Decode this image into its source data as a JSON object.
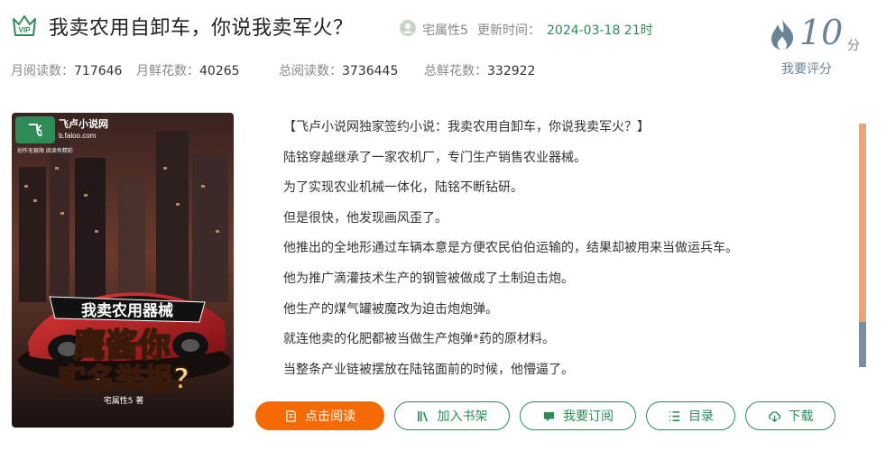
{
  "book": {
    "title": "我卖农用自卸车，你说我卖军火？",
    "author": "宅属性5",
    "update_label": "更新时间：",
    "update_time": "2024-03-18 21时",
    "vip_badge": "VIP"
  },
  "stats": [
    {
      "label": "月阅读数：",
      "value": "717646"
    },
    {
      "label": "月鲜花数：",
      "value": "40265"
    },
    {
      "label": "总阅读数：",
      "value": "3736445"
    },
    {
      "label": "总鲜花数：",
      "value": "332922"
    }
  ],
  "score": {
    "value": "10",
    "unit": "分",
    "rate_label": "我要评分"
  },
  "cover": {
    "site_name": "飞卢小说网",
    "site_url": "b.faloo.com",
    "slogan": "创作无极限 阅读有精彩",
    "banner": "我卖农用器械",
    "big_text_1": "鹰酱你",
    "big_text_2": "实名举报?",
    "author_tag": "宅属性5 著"
  },
  "description": [
    "【飞卢小说网独家签约小说：我卖农用自卸车，你说我卖军火？】",
    "陆铭穿越继承了一家农机厂，专门生产销售农业器械。",
    "为了实现农业机械一体化，陆铭不断钻研。",
    "但是很快，他发现画风歪了。",
    "他推出的全地形通过车辆本意是方便农民伯伯运输的，结果却被用来当做运兵车。",
    "他为推广滴灌技术生产的钢管被做成了土制迫击炮。",
    "他生产的煤气罐被魔改为迫击炮炮弹。",
    "就连他卖的化肥都被当做生产炮弹*药的原材料。",
    "当整条产业链被摆放在陆铭面前的时候，他懵逼了。"
  ],
  "actions": {
    "read": "点击阅读",
    "shelf": "加入书架",
    "subscribe": "我要订阅",
    "toc": "目录",
    "download": "下载"
  },
  "colors": {
    "accent_green": "#2e8b57",
    "read_button": "#f56a05",
    "score_color": "#6b8296"
  }
}
